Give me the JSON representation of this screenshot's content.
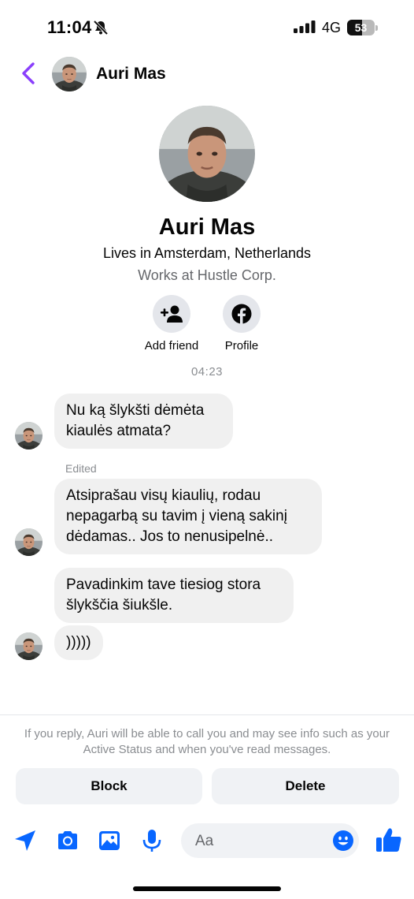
{
  "status_bar": {
    "time": "11:04",
    "network": "4G",
    "battery_percent": "53",
    "battery_level": 0.53,
    "silent_icon": "bell-slash-icon",
    "signal_icon": "cellular-signal-icon"
  },
  "header": {
    "back_icon": "chevron-left-icon",
    "name": "Auri Mas"
  },
  "profile": {
    "name": "Auri Mas",
    "lives": "Lives in Amsterdam, Netherlands",
    "works": "Works at Hustle Corp.",
    "actions": [
      {
        "label": "Add friend",
        "icon": "add-person-icon"
      },
      {
        "label": "Profile",
        "icon": "facebook-icon"
      }
    ]
  },
  "conversation": {
    "timestamp": "04:23",
    "edited_label": "Edited",
    "messages": [
      {
        "text": "Nu ką šlykšti dėmėta kiaulės atmata?"
      },
      {
        "text": "Atsiprašau visų kiaulių, rodau nepagarbą su tavim į vieną sakinį dėdamas.. Jos to nenusipelnė.."
      },
      {
        "text": "Pavadinkim tave tiesiog stora šlykščia šiukšle."
      },
      {
        "text": ")))))"
      }
    ]
  },
  "reply_notice": {
    "text": "If you reply, Auri will be able to call you and may see info such as your Active Status and when you've read messages.",
    "block_label": "Block",
    "delete_label": "Delete"
  },
  "composer": {
    "placeholder": "Aa",
    "icons": [
      "location-arrow-icon",
      "camera-icon",
      "gallery-icon",
      "microphone-icon",
      "emoji-icon",
      "thumbs-up-icon"
    ]
  },
  "colors": {
    "accent": "#0866ff",
    "back_purple": "#8a3ffc",
    "bubble": "#f0f0f0",
    "secondary_text": "#65676b"
  }
}
